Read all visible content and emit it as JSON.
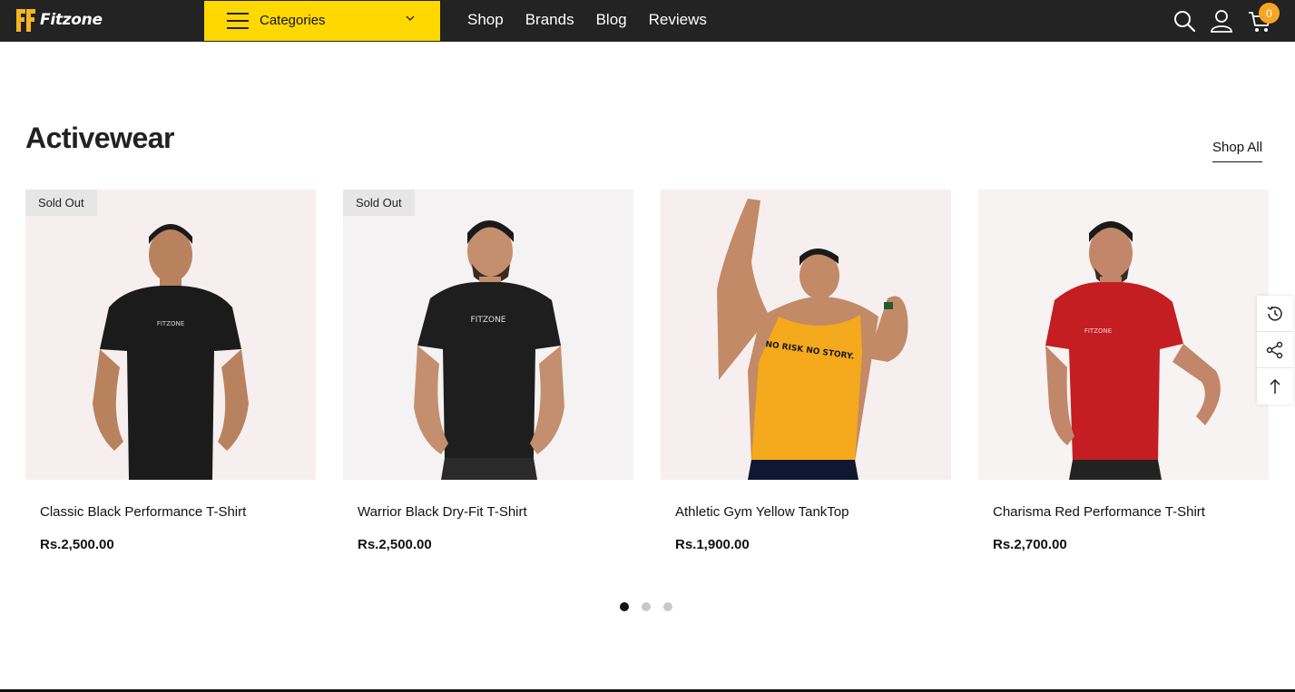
{
  "header": {
    "logo_text": "Fitzone",
    "categories_label": "Categories",
    "nav": [
      "Shop",
      "Brands",
      "Blog",
      "Reviews"
    ],
    "cart_count": "0",
    "icons": [
      "search-icon",
      "user-icon",
      "cart-icon"
    ]
  },
  "section": {
    "title": "Activewear",
    "shop_all": "Shop All"
  },
  "products": [
    {
      "title": "Classic Black Performance T-Shirt",
      "price": "Rs.2,500.00",
      "badge": "Sold Out",
      "shirt_color": "#1b1b1b",
      "print": "FITZONE"
    },
    {
      "title": "Warrior Black Dry-Fit T-Shirt",
      "price": "Rs.2,500.00",
      "badge": "Sold Out",
      "shirt_color": "#1e1e1e",
      "print": "FITZONE"
    },
    {
      "title": "Athletic Gym Yellow TankTop",
      "price": "Rs.1,900.00",
      "badge": "",
      "shirt_color": "#f5a91c",
      "print": "NO RISK NO STORY."
    },
    {
      "title": "Charisma Red Performance T-Shirt",
      "price": "Rs.2,700.00",
      "badge": "",
      "shirt_color": "#c41e22",
      "print": "FITZONE"
    }
  ],
  "carousel": {
    "pages": 3,
    "active": 1
  },
  "side_tools": [
    "recent-icon",
    "share-icon",
    "back-to-top-icon"
  ],
  "colors": {
    "header_bg": "#232323",
    "accent": "#ffd800",
    "badge_bg": "#f5a623",
    "card_bg": "#f7f1f0"
  }
}
